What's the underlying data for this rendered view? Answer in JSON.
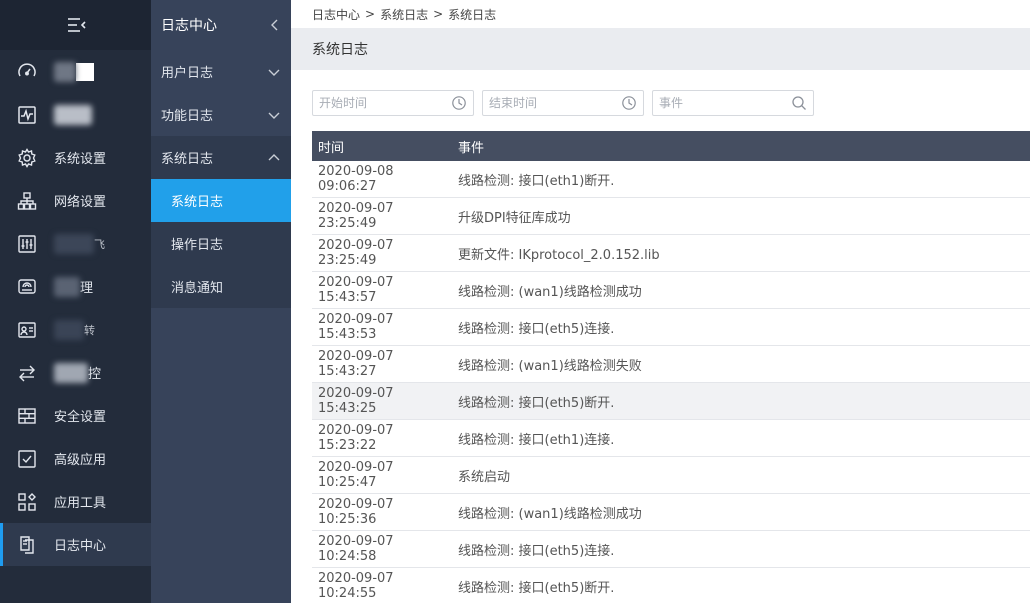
{
  "nav1": {
    "items": [
      {
        "label": "",
        "icon": "dashboard-icon",
        "blurred": true
      },
      {
        "label": "",
        "icon": "monitor-icon",
        "blurred": true
      },
      {
        "label": "系统设置",
        "icon": "gear-icon"
      },
      {
        "label": "网络设置",
        "icon": "network-icon"
      },
      {
        "label": "",
        "icon": "sliders-icon",
        "blurred": true
      },
      {
        "label": "",
        "icon": "router-icon",
        "blurred": true
      },
      {
        "label": "",
        "icon": "user-card-icon",
        "blurred": true
      },
      {
        "label": "",
        "icon": "flow-icon",
        "blurred": true
      },
      {
        "label": "安全设置",
        "icon": "firewall-icon"
      },
      {
        "label": "高级应用",
        "icon": "check-box-icon"
      },
      {
        "label": "应用工具",
        "icon": "tools-icon"
      },
      {
        "label": "日志中心",
        "icon": "log-icon",
        "active": true
      }
    ],
    "blur_tails": [
      "",
      "",
      "",
      "",
      "飞",
      "理",
      "转",
      "控"
    ]
  },
  "nav2": {
    "title": "日志中心",
    "groups": [
      {
        "label": "用户日志"
      },
      {
        "label": "功能日志"
      },
      {
        "label": "系统日志",
        "open": true
      }
    ],
    "subs": [
      {
        "label": "系统日志",
        "selected": true
      },
      {
        "label": "操作日志"
      },
      {
        "label": "消息通知"
      }
    ]
  },
  "breadcrumb": {
    "a": "日志中心",
    "b": "系统日志",
    "c": "系统日志",
    "sep": ">"
  },
  "page_title": "系统日志",
  "filters": {
    "start_placeholder": "开始时间",
    "end_placeholder": "结束时间",
    "event_placeholder": "事件"
  },
  "table": {
    "headers": {
      "time": "时间",
      "event": "事件"
    },
    "rows": [
      {
        "time": "2020-09-08 09:06:27",
        "event": "线路检测: 接口(eth1)断开."
      },
      {
        "time": "2020-09-07 23:25:49",
        "event": "升级DPI特征库成功"
      },
      {
        "time": "2020-09-07 23:25:49",
        "event": "更新文件: IKprotocol_2.0.152.lib"
      },
      {
        "time": "2020-09-07 15:43:57",
        "event": "线路检测: (wan1)线路检测成功"
      },
      {
        "time": "2020-09-07 15:43:53",
        "event": "线路检测: 接口(eth5)连接."
      },
      {
        "time": "2020-09-07 15:43:27",
        "event": "线路检测: (wan1)线路检测失败"
      },
      {
        "time": "2020-09-07 15:43:25",
        "event": "线路检测: 接口(eth5)断开."
      },
      {
        "time": "2020-09-07 15:23:22",
        "event": "线路检测: 接口(eth1)连接."
      },
      {
        "time": "2020-09-07 10:25:47",
        "event": "系统启动"
      },
      {
        "time": "2020-09-07 10:25:36",
        "event": "线路检测: (wan1)线路检测成功"
      },
      {
        "time": "2020-09-07 10:24:58",
        "event": "线路检测: 接口(eth5)连接."
      },
      {
        "time": "2020-09-07 10:24:55",
        "event": "线路检测: 接口(eth5)断开."
      }
    ]
  },
  "colors": {
    "nav1_bg": "#232c3b",
    "nav2_bg": "#37435a",
    "accent": "#21a0ea",
    "table_head": "#454e61"
  }
}
